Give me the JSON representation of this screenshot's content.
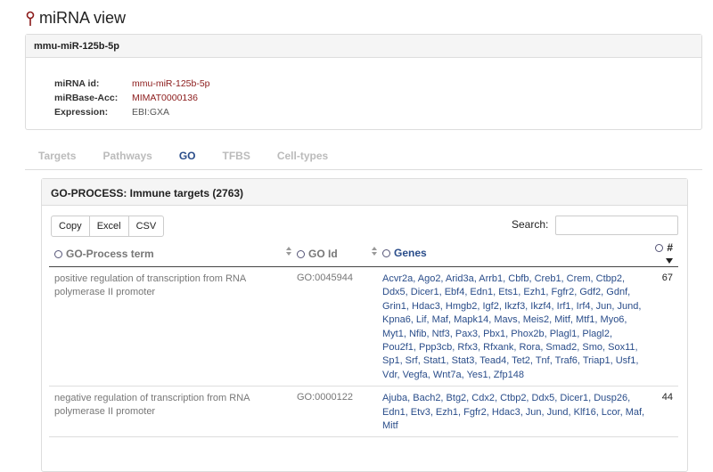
{
  "page": {
    "title": "miRNA view"
  },
  "info": {
    "header": "mmu-miR-125b-5p",
    "rows": [
      {
        "key": "miRNA id:",
        "value": "mmu-miR-125b-5p"
      },
      {
        "key": "miRBase-Acc:",
        "value": "MIMAT0000136"
      },
      {
        "key": "Expression:",
        "value": "EBI:GXA"
      }
    ]
  },
  "tabs": [
    "Targets",
    "Pathways",
    "GO",
    "TFBS",
    "Cell-types"
  ],
  "active_tab": "GO",
  "go": {
    "header": "GO-PROCESS: Immune targets (2763)",
    "buttons": [
      "Copy",
      "Excel",
      "CSV"
    ],
    "search_label": "Search:",
    "search_value": "",
    "columns": [
      "GO-Process term",
      "GO Id",
      "Genes",
      "#"
    ],
    "rows": [
      {
        "term": "positive regulation of transcription from RNA polymerase II promoter",
        "go_id": "GO:0045944",
        "genes": "Acvr2a, Ago2, Arid3a, Arrb1, Cbfb, Creb1, Crem, Ctbp2, Ddx5, Dicer1, Ebf4, Edn1, Ets1, Ezh1, Fgfr2, Gdf2, Gdnf, Grin1, Hdac3, Hmgb2, Igf2, Ikzf3, Ikzf4, Irf1, Irf4, Jun, Jund, Kpna6, Lif, Maf, Mapk14, Mavs, Meis2, Mitf, Mtf1, Myo6, Myt1, Nfib, Ntf3, Pax3, Pbx1, Phox2b, Plagl1, Plagl2, Pou2f1, Ppp3cb, Rfx3, Rfxank, Rora, Smad2, Smo, Sox11, Sp1, Srf, Stat1, Stat3, Tead4, Tet2, Tnf, Traf6, Triap1, Usf1, Vdr, Vegfa, Wnt7a, Yes1, Zfp148",
        "count": "67"
      },
      {
        "term": "negative regulation of transcription from RNA polymerase II promoter",
        "go_id": "GO:0000122",
        "genes": "Ajuba, Bach2, Btg2, Cdx2, Ctbp2, Ddx5, Dicer1, Dusp26, Edn1, Etv3, Ezh1, Fgfr2, Hdac3, Jun, Jund, Klf16, Lcor, Maf, Mitf",
        "count": "44"
      }
    ]
  }
}
